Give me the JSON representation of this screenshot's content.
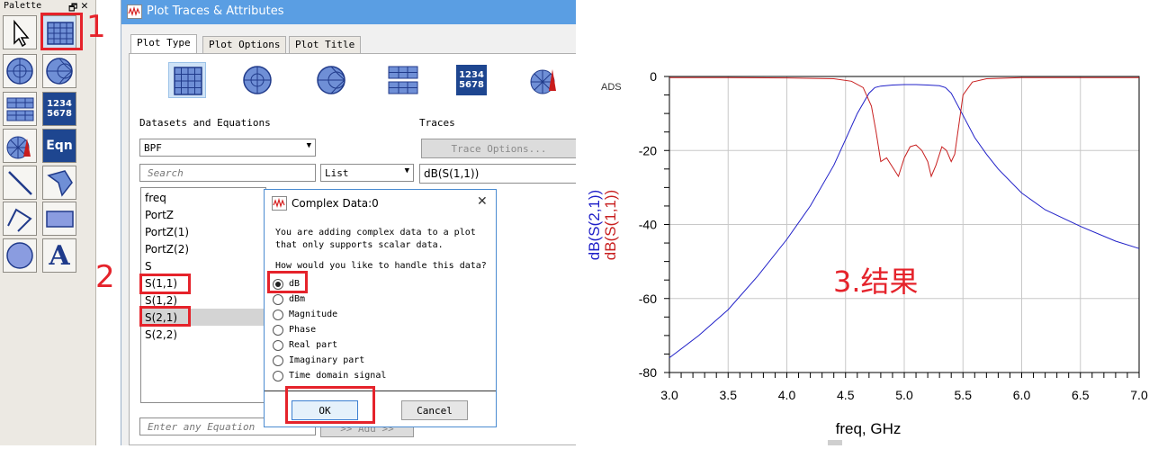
{
  "palette": {
    "title": "Palette",
    "pin_glyph": "🗗",
    "close_glyph": "✕",
    "num_icon_text": "1234\n5678",
    "eqn_label": "Eqn",
    "text_icon_letter": "A"
  },
  "annotations": {
    "step1": "1",
    "step2": "2",
    "step3": "3.结果"
  },
  "window": {
    "title": "Plot Traces & Attributes",
    "tabs": [
      "Plot Type",
      "Plot Options",
      "Plot Title"
    ],
    "plot_type_num_text": "1234\n5678",
    "datasets_label": "Datasets and Equations",
    "traces_label": "Traces",
    "dataset_value": "BPF",
    "trace_options_label": "Trace Options...",
    "search_placeholder": "Search",
    "list_mode_value": "List",
    "trace_item": "dB(S(1,1))",
    "list_items": [
      "freq",
      "PortZ",
      "PortZ(1)",
      "PortZ(2)",
      "S",
      "S(1,1)",
      "S(1,2)",
      "S(2,1)",
      "S(2,2)"
    ],
    "equation_placeholder": "Enter any Equation",
    "add_label": ">> Add >>"
  },
  "dialog": {
    "title": "Complex Data:0",
    "close_glyph": "✕",
    "message_line1": "You are adding complex data to a plot",
    "message_line2": "that only supports scalar data.",
    "question": "How would you like to handle this data?",
    "options": [
      "dB",
      "dBm",
      "Magnitude",
      "Phase",
      "Real part",
      "Imaginary part",
      "Time domain signal"
    ],
    "selected_option": "dB",
    "ok_label": "OK",
    "cancel_label": "Cancel"
  },
  "chart_data": {
    "type": "line",
    "watermark": "ADS",
    "xlabel": "freq, GHz",
    "ylabels": [
      "dB(S(2,1))",
      "dB(S(1,1))"
    ],
    "xlim": [
      3.0,
      7.0
    ],
    "ylim": [
      -80,
      0
    ],
    "xticks": [
      "3.0",
      "3.5",
      "4.0",
      "4.5",
      "5.0",
      "5.5",
      "6.0",
      "6.5",
      "7.0"
    ],
    "yticks": [
      "0",
      "-20",
      "-40",
      "-60",
      "-80"
    ],
    "grid": true,
    "colors": {
      "s21": "#2020c8",
      "s11": "#c82020",
      "grid": "#c8c8c8"
    },
    "series": [
      {
        "name": "dB(S(2,1))",
        "x": [
          3.0,
          3.25,
          3.5,
          3.75,
          4.0,
          4.2,
          4.4,
          4.5,
          4.6,
          4.7,
          4.75,
          4.8,
          4.9,
          5.0,
          5.1,
          5.2,
          5.3,
          5.35,
          5.4,
          5.5,
          5.6,
          5.7,
          5.8,
          6.0,
          6.2,
          6.5,
          6.8,
          7.0
        ],
        "y": [
          -76.0,
          -70.0,
          -63.0,
          -54.0,
          -44.0,
          -35.0,
          -24.0,
          -17.0,
          -10.0,
          -4.5,
          -3.0,
          -2.6,
          -2.3,
          -2.2,
          -2.2,
          -2.3,
          -2.5,
          -3.0,
          -4.5,
          -10.5,
          -16.5,
          -21.0,
          -25.0,
          -31.5,
          -36.0,
          -40.5,
          -44.5,
          -46.5
        ]
      },
      {
        "name": "dB(S(1,1))",
        "x": [
          3.0,
          3.5,
          4.0,
          4.4,
          4.55,
          4.65,
          4.72,
          4.76,
          4.8,
          4.85,
          4.95,
          5.0,
          5.05,
          5.1,
          5.15,
          5.2,
          5.23,
          5.27,
          5.32,
          5.36,
          5.4,
          5.43,
          5.47,
          5.5,
          5.58,
          5.7,
          6.0,
          6.5,
          7.0
        ],
        "y": [
          -0.3,
          -0.3,
          -0.4,
          -0.6,
          -1.3,
          -3.0,
          -8.0,
          -15.0,
          -23.0,
          -22.0,
          -27.0,
          -22.0,
          -19.0,
          -18.5,
          -20.0,
          -23.0,
          -27.0,
          -24.0,
          -19.0,
          -20.0,
          -23.0,
          -21.0,
          -12.0,
          -5.0,
          -1.5,
          -0.6,
          -0.3,
          -0.3,
          -0.3
        ]
      }
    ]
  }
}
